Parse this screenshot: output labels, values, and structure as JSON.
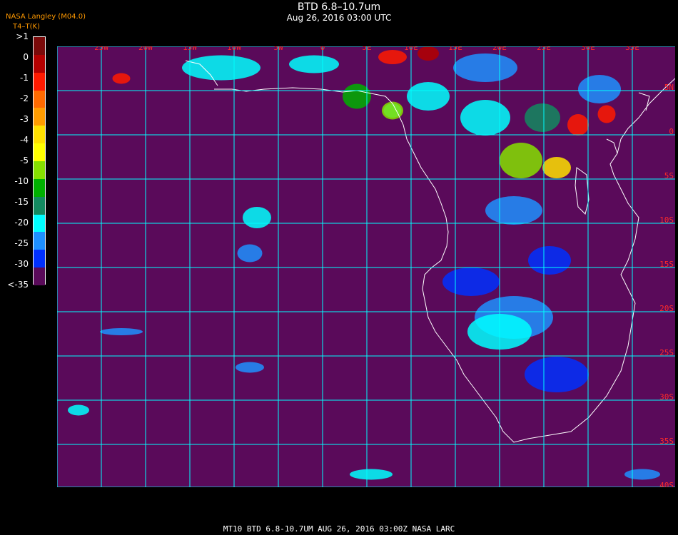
{
  "header": {
    "title": "BTD 6.8–10.7um",
    "datetime": "Aug 26, 2016 03:00 UTC",
    "source": "NASA Langley (M04.0)",
    "variable_label": "BTD",
    "unit_label": "T4–T(K)"
  },
  "legend": {
    "labels": [
      ">1",
      "0",
      "-1",
      "-2",
      "-3",
      "-4",
      "-5",
      "-10",
      "-15",
      "-20",
      "-25",
      "-30",
      "<-35"
    ],
    "colors": [
      "#7a0a0a",
      "#b40000",
      "#ff1a00",
      "#ff6a00",
      "#ff9c00",
      "#ffe000",
      "#ffff00",
      "#86e000",
      "#00b000",
      "#138a60",
      "#00ffff",
      "#1e90ff",
      "#0030ff",
      "#5a0a5a"
    ]
  },
  "map": {
    "background": "#5a0a5a",
    "grid_color": "#00ffff",
    "coast_color": "#ffffff",
    "lon_labels": [
      "25W",
      "20W",
      "15W",
      "10W",
      "5W",
      "0",
      "5E",
      "10E",
      "15E",
      "20E",
      "25E",
      "30E",
      "35E"
    ],
    "lat_labels": [
      "5N",
      "0",
      "5S",
      "10S",
      "15S",
      "20S",
      "25S",
      "30S",
      "35S",
      "40S"
    ]
  },
  "footer": {
    "text": "MT10   BTD 6.8-10.7UM    AUG 26, 2016 03:00Z    NASA LARC"
  }
}
